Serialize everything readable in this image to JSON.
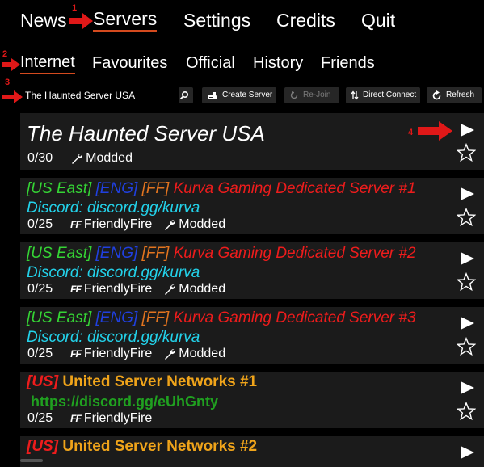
{
  "nav": {
    "items": [
      "News",
      "Servers",
      "Settings",
      "Credits",
      "Quit"
    ],
    "active": "Servers"
  },
  "tabs": {
    "items": [
      "Internet",
      "Favourites",
      "Official",
      "History",
      "Friends"
    ],
    "active": "Internet"
  },
  "toolbar": {
    "search_value": "The Haunted Server USA",
    "create_server": "Create Server",
    "rejoin": "Re-Join",
    "direct_connect": "Direct Connect",
    "refresh": "Refresh"
  },
  "servers": [
    {
      "name": "The Haunted Server USA",
      "players": "0/30",
      "tags": [
        "Modded"
      ]
    },
    {
      "region": "[US East]",
      "lang": "[ENG]",
      "ff": "[FF]",
      "title": "Kurva Gaming Dedicated Server #1",
      "discord": "Discord: discord.gg/kurva",
      "players": "0/25",
      "tags": [
        "FriendlyFire",
        "Modded"
      ]
    },
    {
      "region": "[US East]",
      "lang": "[ENG]",
      "ff": "[FF]",
      "title": "Kurva Gaming Dedicated Server #2",
      "discord": "Discord: discord.gg/kurva",
      "players": "0/25",
      "tags": [
        "FriendlyFire",
        "Modded"
      ]
    },
    {
      "region": "[US East]",
      "lang": "[ENG]",
      "ff": "[FF]",
      "title": "Kurva Gaming Dedicated Server #3",
      "discord": "Discord: discord.gg/kurva",
      "players": "0/25",
      "tags": [
        "FriendlyFire",
        "Modded"
      ]
    },
    {
      "prefix": "[US]",
      "title": "United Server Networks #1",
      "link": "https://discord.gg/eUhGnty",
      "players": "0/25",
      "tags": [
        "FriendlyFire"
      ]
    },
    {
      "prefix": "[US]",
      "title": "United Server Networks #2"
    }
  ],
  "annotations": [
    "1",
    "2",
    "3",
    "4"
  ],
  "colors": {
    "accent_underline": "#d44a1e",
    "annotation_red": "#e01818",
    "card_bg": "#1b1b1b",
    "button_bg": "#262626",
    "region_green": "#35d435",
    "lang_blue": "#2040e0",
    "ff_orange": "#e2741f",
    "title_red": "#ee1c1c",
    "discord_cyan": "#23d2ea",
    "usn_gold": "#f0a41a",
    "usn_link_green": "#20a020"
  },
  "icons": [
    "search-icon",
    "create-server-icon",
    "rejoin-icon",
    "direct-connect-icon",
    "refresh-icon",
    "wrench-icon",
    "friendlyfire-icon",
    "play-icon",
    "star-icon",
    "arrow-icon"
  ]
}
